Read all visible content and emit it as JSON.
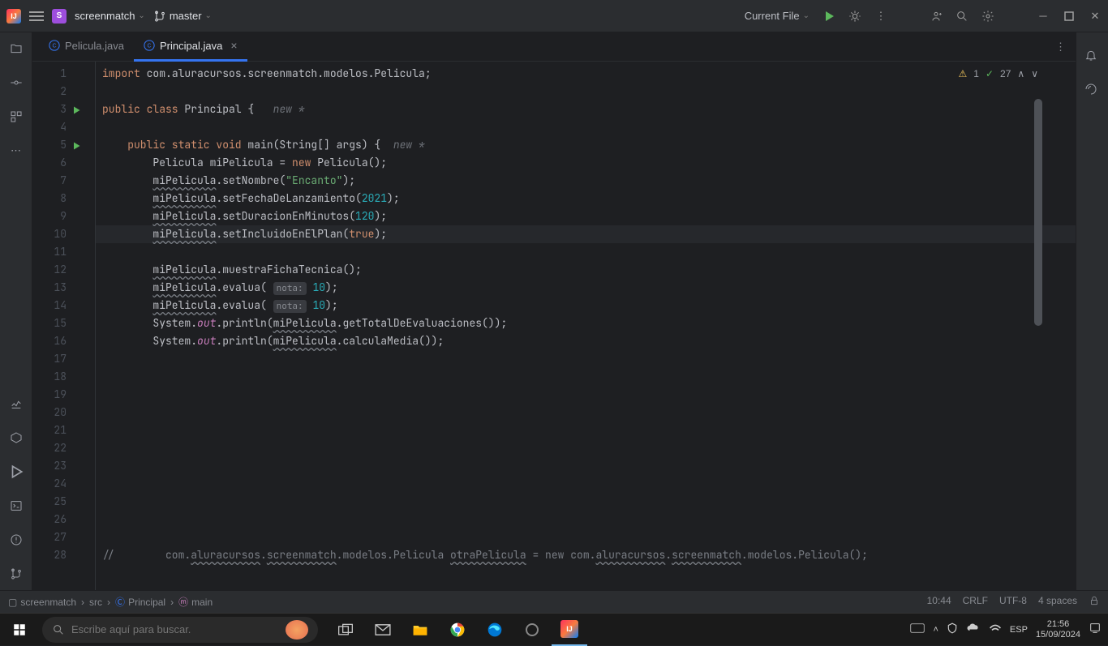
{
  "titlebar": {
    "project": "screenmatch",
    "branch": "master",
    "runConfig": "Current File"
  },
  "tabs": [
    {
      "label": "Pelicula.java",
      "active": false
    },
    {
      "label": "Principal.java",
      "active": true
    }
  ],
  "inspection": {
    "warnings": "1",
    "checks": "27"
  },
  "code": {
    "lines": [
      {
        "n": 1,
        "html": "<span class='kw'>import</span> com.aluracursos.screenmatch.modelos.Pelicula;"
      },
      {
        "n": 2,
        "html": ""
      },
      {
        "n": 3,
        "html": "<span class='kw'>public class</span> <span class='fn'>Principal</span> {   <span class='hint-text'>new *</span>",
        "run": true
      },
      {
        "n": 4,
        "html": ""
      },
      {
        "n": 5,
        "html": "    <span class='kw'>public static void</span> <span class='fn'>main</span>(String[] args) {  <span class='hint-text'>new *</span>",
        "run": true
      },
      {
        "n": 6,
        "html": "        Pelicula miPelicula = <span class='kw'>new</span> Pelicula();"
      },
      {
        "n": 7,
        "html": "        <span class='typo'>miPelicula</span>.setNombre(<span class='str'>\"Encanto\"</span>);"
      },
      {
        "n": 8,
        "html": "        <span class='typo'>miPelicula</span>.setFechaDeLanzamiento(<span class='num'>2021</span>);"
      },
      {
        "n": 9,
        "html": "        <span class='typo'>miPelicula</span>.setDuracionEnMinutos(<span class='num'>120</span>);"
      },
      {
        "n": 10,
        "html": "        <span class='typo'>miPelicula</span>.setIncluidoEnElPlan(<span class='kw'>true</span>);",
        "highlighted": true
      },
      {
        "n": 11,
        "html": ""
      },
      {
        "n": 12,
        "html": "        <span class='typo'>miPelicula</span>.muestraFichaTecnica();"
      },
      {
        "n": 13,
        "html": "        <span class='typo'>miPelicula</span>.evalua( <span class='param-hint'>nota:</span> <span class='num'>10</span>);"
      },
      {
        "n": 14,
        "html": "        <span class='typo'>miPelicula</span>.evalua( <span class='param-hint'>nota:</span> <span class='num'>10</span>);"
      },
      {
        "n": 15,
        "html": "        System.<span class='field'>out</span>.println(<span class='typo'>miPelicula</span>.getTotalDeEvaluaciones());"
      },
      {
        "n": 16,
        "html": "        System.<span class='field'>out</span>.println(<span class='typo'>miPelicula</span>.calculaMedia());"
      },
      {
        "n": 17,
        "html": ""
      },
      {
        "n": 18,
        "html": ""
      },
      {
        "n": 19,
        "html": ""
      },
      {
        "n": 20,
        "html": ""
      },
      {
        "n": 21,
        "html": ""
      },
      {
        "n": 22,
        "html": ""
      },
      {
        "n": 23,
        "html": ""
      },
      {
        "n": 24,
        "html": ""
      },
      {
        "n": 25,
        "html": ""
      },
      {
        "n": 26,
        "html": ""
      },
      {
        "n": 27,
        "html": ""
      },
      {
        "n": 28,
        "html": "<span class='comment'>//        com.<span class='typo'>aluracursos</span>.<span class='typo'>screenmatch</span>.modelos.Pelicula <span class='typo'>otraPelicula</span> = new com.<span class='typo'>aluracursos</span>.<span class='typo'>screenmatch</span>.modelos.Pelicula();</span>"
      }
    ]
  },
  "breadcrumb": {
    "items": [
      "screenmatch",
      "src",
      "Principal",
      "main"
    ],
    "status": {
      "position": "10:44",
      "lineSep": "CRLF",
      "encoding": "UTF-8",
      "indent": "4 spaces"
    }
  },
  "taskbar": {
    "searchPlaceholder": "Escribe aquí para buscar.",
    "lang": "ESP",
    "time": "21:56",
    "date": "15/09/2024"
  }
}
